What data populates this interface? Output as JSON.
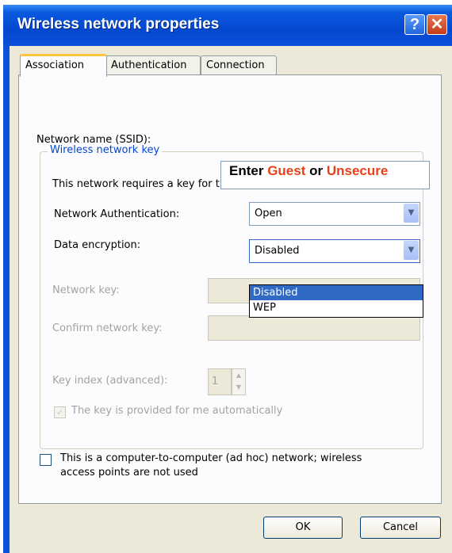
{
  "window": {
    "title": "Wireless network properties",
    "help_glyph": "?",
    "close_glyph": "✕"
  },
  "tabs": [
    {
      "label": "Association",
      "active": true
    },
    {
      "label": "Authentication",
      "active": false
    },
    {
      "label": "Connection",
      "active": false
    }
  ],
  "ssid": {
    "label": "Network name (SSID):",
    "annotation": {
      "part1": "Enter ",
      "part2": "Guest",
      "part3": " or ",
      "part4": "Unsecure"
    }
  },
  "wireless_key": {
    "group_title": "Wireless network key",
    "requires_text": "This network requires a key for the following:",
    "auth_label": "Network Authentication:",
    "auth_value": "Open",
    "enc_label": "Data encryption:",
    "enc_value": "Disabled",
    "enc_options": [
      "Disabled",
      "WEP"
    ],
    "key_label": "Network key:",
    "confirm_label": "Confirm network key:",
    "index_label": "Key index (advanced):",
    "index_value": "1",
    "auto_label": "The key is provided for me automatically"
  },
  "adhoc": {
    "line1": "This is a computer-to-computer (ad hoc) network; wireless",
    "line2": "access points are not used"
  },
  "buttons": {
    "ok": "OK",
    "cancel": "Cancel"
  },
  "colors": {
    "title_bar": "#0a53d8",
    "highlight": "#316ac5",
    "annotation_red": "#e8401a"
  }
}
